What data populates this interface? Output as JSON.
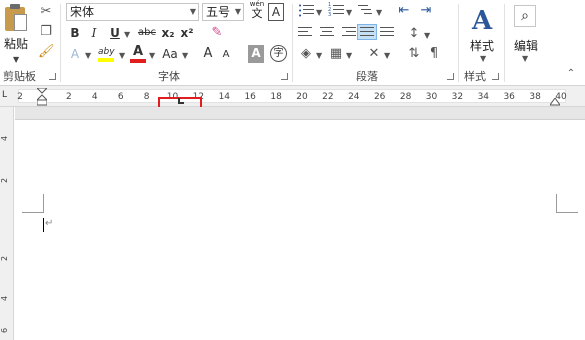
{
  "clipboard": {
    "paste_label": "粘贴",
    "group_label": "剪贴板"
  },
  "font": {
    "family_value": "宋体",
    "size_value": "五号",
    "phonetic_label": "wén",
    "phonetic_glyph": "文",
    "char_border_glyph": "A",
    "bold": "B",
    "italic": "I",
    "underline": "U",
    "strikethrough": "abc",
    "subscript": "x₂",
    "superscript": "x²",
    "text_effects": "A",
    "highlight": "aby",
    "font_color": "A",
    "change_case": "Aa",
    "grow": "A",
    "shrink": "A",
    "char_shading": "A",
    "enclose": "字",
    "group_label": "字体"
  },
  "paragraph": {
    "group_label": "段落"
  },
  "styles": {
    "button_label": "样式",
    "group_label": "样式"
  },
  "editing": {
    "button_label": "编辑"
  },
  "ruler": {
    "tab_selector": "L",
    "labels": [
      "2",
      "2",
      "4",
      "6",
      "8",
      "10",
      "12",
      "14",
      "16",
      "18",
      "20",
      "22",
      "24",
      "26",
      "28",
      "30",
      "32",
      "34",
      "36",
      "38",
      "40"
    ],
    "vertical_labels": [
      "4",
      "2",
      "2",
      "4",
      "6"
    ]
  },
  "colors": {
    "highlight_yellow": "#ffff00",
    "font_red": "#e01e1e",
    "focus_box": "#e01e1e",
    "styles_blue": "#2b579a"
  }
}
